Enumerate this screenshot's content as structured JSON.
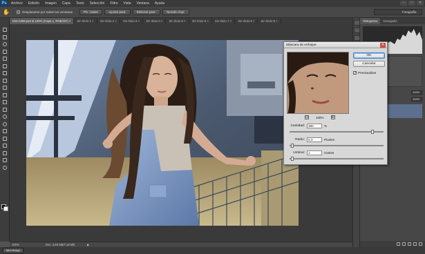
{
  "app": {
    "logo": "Ps",
    "menu": [
      "Archivo",
      "Edición",
      "Imagen",
      "Capa",
      "Texto",
      "Selección",
      "Filtro",
      "Vista",
      "Ventana",
      "Ayuda"
    ],
    "window_controls": [
      "–",
      "□",
      "✕"
    ]
  },
  "options_bar": {
    "scroll_all_label": "Desplazarse por todas las ventanas",
    "buttons": [
      "Píx. reales",
      "Ajustar pant.",
      "Rellenar pant.",
      "Tamaño impr."
    ],
    "workspace": "Fotografía"
  },
  "tabs": [
    {
      "label": "DSC1259.psd al 100% (Capa 1, RGB/16*) ×",
      "active": true
    },
    {
      "label": "Sin título-1 ×",
      "active": false
    },
    {
      "label": "Sin título-2 ×",
      "active": false
    },
    {
      "label": "Sin título-3 ×",
      "active": false
    },
    {
      "label": "Sin título-4 ×",
      "active": false
    },
    {
      "label": "Sin título-5 ×",
      "active": false
    },
    {
      "label": "Sin título-6 ×",
      "active": false
    },
    {
      "label": "Sin título-7 ×",
      "active": false
    },
    {
      "label": "Sin título-8 ×",
      "active": false
    },
    {
      "label": "Sin título-9 ×",
      "active": false
    }
  ],
  "status": {
    "zoom": "100%",
    "doc_info": "Doc: 3,59 MB/7,18 MB",
    "arrow": "▶"
  },
  "minibridge": "Mini Bridge",
  "panels": {
    "tabs": [
      "Histograma",
      "Navegador"
    ],
    "opacity_label": "Opacidad:",
    "opacity_value": "100%",
    "fill_label": "Relleno:",
    "fill_value": "100%"
  },
  "dialog": {
    "title": "Máscara de enfoque",
    "ok": "OK",
    "cancel": "Cancelar",
    "preview_label": "Previsualizar",
    "preview_checked": true,
    "zoom_minus": "⊟",
    "zoom_value": "100%",
    "zoom_plus": "⊞",
    "amount_label": "Cantidad:",
    "amount_value": "380",
    "amount_unit": "%",
    "amount_level": 0.9,
    "radius_label": "Radio:",
    "radius_value": "0,3",
    "radius_unit": "Píxeles",
    "radius_level": 0.01,
    "threshold_label": "Umbral:",
    "threshold_value": "1",
    "threshold_unit": "niveles",
    "threshold_level": 0.01
  },
  "colors": {
    "accent": "#3c7fc8",
    "chrome_dark": "#3a3a3a",
    "panel": "#474747"
  }
}
